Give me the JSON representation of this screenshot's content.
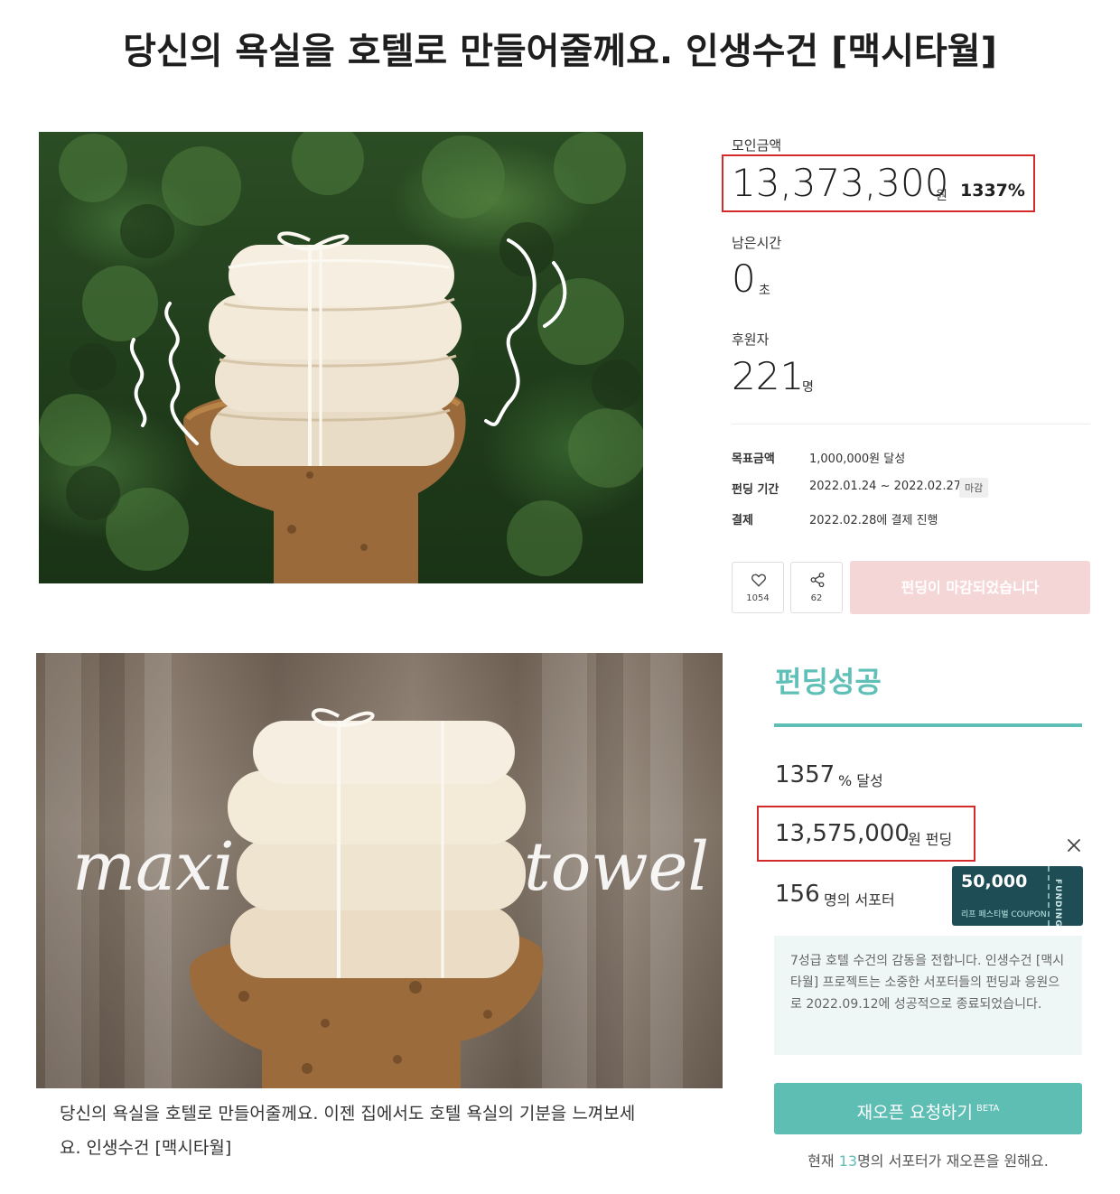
{
  "title": "당신의 욕실을 호텔로 만들어줄께요. 인생수건 [맥시타월]",
  "stats": {
    "raised_label": "모인금액",
    "raised_value": "13,373,300",
    "raised_unit": "원",
    "raised_percent": "1337%",
    "remaining_label": "남은시간",
    "remaining_value": "0",
    "remaining_unit": "초",
    "supporters_label": "후원자",
    "supporters_value": "221",
    "supporters_unit": "명"
  },
  "meta": {
    "goal_key": "목표금액",
    "goal_val": "1,000,000원 달성",
    "period_key": "펀딩 기간",
    "period_val": "2022.01.24 ~ 2022.02.27",
    "period_tag": "마감",
    "payment_key": "결제",
    "payment_val": "2022.02.28에 결제 진행"
  },
  "actions": {
    "like_count": "1054",
    "share_count": "62",
    "closed_label": "펀딩이 마감되었습니다"
  },
  "image2": {
    "overlay_left": "maxi",
    "overlay_right": "towel"
  },
  "caption": "당신의 욕실을 호텔로 만들어줄께요. 이젠 집에서도 호텔 욕실의 기분을 느껴보세요. 인생수건 [맥시타월]",
  "success": {
    "title": "펀딩성공",
    "percent_value": "1357",
    "percent_unit": "% 달성",
    "amount_value": "13,575,000",
    "amount_unit": "원 펀딩",
    "supporters_value": "156",
    "supporters_unit": "명의 서포터",
    "info": "7성급 호텔 수건의 감동을 전합니다. 인생수건 [맥시타월] 프로젝트는 소중한 서포터들의 펀딩과 응원으로 2022.09.12에 성공적으로 종료되었습니다.",
    "reopen_label": "재오픈 요청하기",
    "reopen_badge": "BETA",
    "note_prefix": "현재 ",
    "note_count": "13",
    "note_suffix": "명의 서포터가 재오픈을 원해요."
  },
  "coupon": {
    "amount": "50,000",
    "festival": "리프 페스티벌 COUPON",
    "side": "FUNDING"
  },
  "colors": {
    "accent": "#5ebeb4",
    "closed_bg": "#f5d6d6",
    "highlight_box": "#d42a2a",
    "coupon_bg": "#1f4d55"
  }
}
